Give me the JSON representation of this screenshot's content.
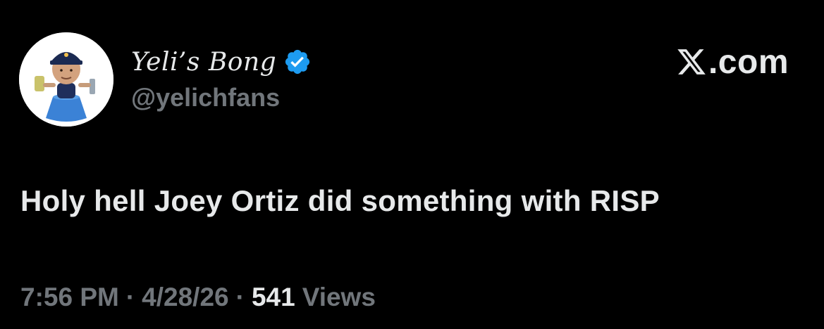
{
  "author": {
    "display_name": "Yeli’s Bong",
    "handle": "@yelichfans",
    "verified": true,
    "avatar_icon": "bobblehead-avatar-icon",
    "verified_icon": "verified-badge-icon"
  },
  "brand": {
    "logo_icon": "x-logo-icon",
    "label": ".com"
  },
  "tweet": {
    "text": "Holy hell Joey Ortiz did something with RISP"
  },
  "meta": {
    "time": "7:56 PM",
    "separator": "·",
    "date": "4/28/26",
    "views_count": "541",
    "views_label": "Views"
  },
  "colors": {
    "background": "#000000",
    "primary_text": "#e7e9ea",
    "secondary_text": "#71767b",
    "verified_blue": "#1d9bf0"
  }
}
